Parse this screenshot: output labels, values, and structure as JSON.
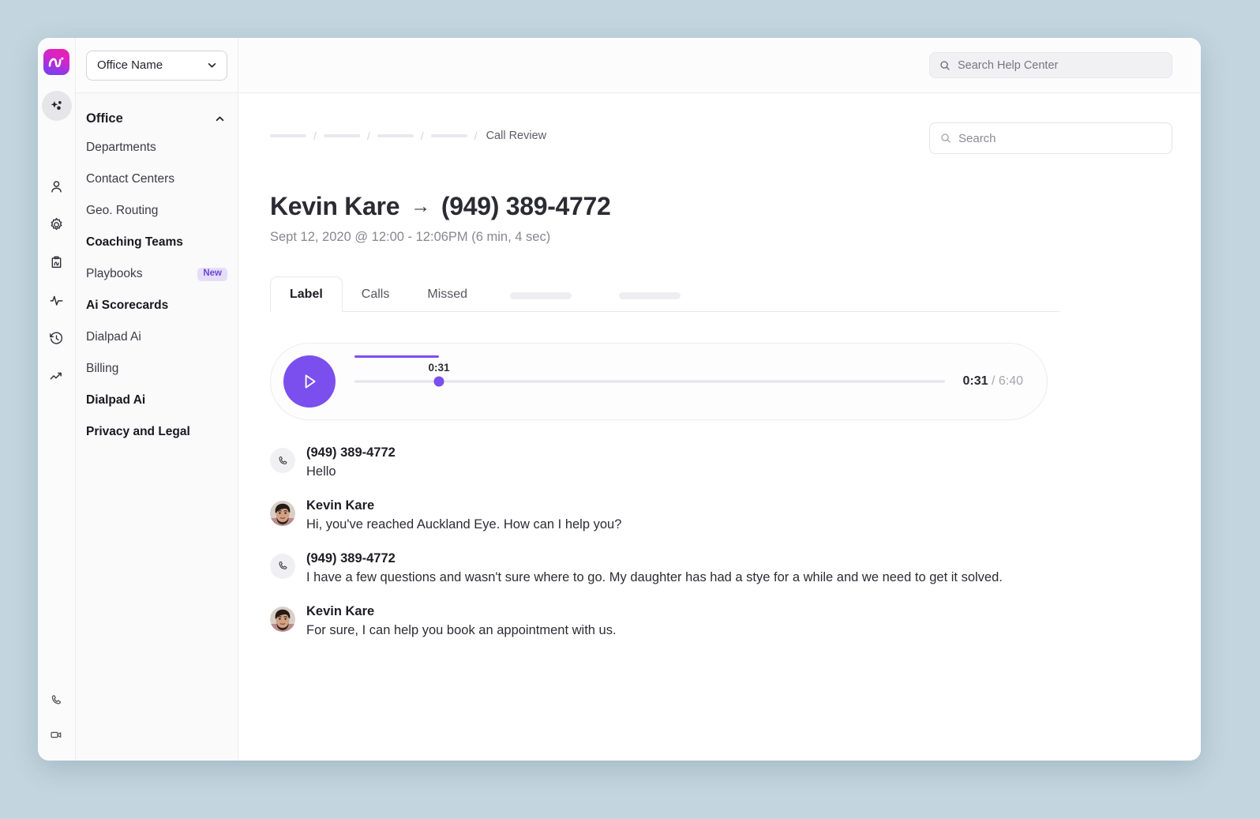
{
  "brand": {
    "logo_icon": "dialpad-ai-logo",
    "accent_purple": "#7b4fee",
    "badge_bg": "#e6def9",
    "badge_fg": "#6b46d6"
  },
  "icon_rail": {
    "items": [
      {
        "icon": "sparkle-ai-icon",
        "name": "ai",
        "active": true
      },
      {
        "icon": "person-icon",
        "name": "contacts",
        "active": false
      },
      {
        "icon": "gear-icon",
        "name": "settings",
        "active": false
      },
      {
        "icon": "clipboard-ai-icon",
        "name": "scorecards",
        "active": false
      },
      {
        "icon": "activity-pulse-icon",
        "name": "activity",
        "active": false
      },
      {
        "icon": "history-clock-icon",
        "name": "history",
        "active": false
      },
      {
        "icon": "trending-up-icon",
        "name": "analytics",
        "active": false
      }
    ],
    "bottom_items": [
      {
        "icon": "phone-icon",
        "name": "calls"
      },
      {
        "icon": "video-camera-icon",
        "name": "meetings"
      }
    ]
  },
  "sidebar": {
    "office_select": {
      "value": "Office Name",
      "chevron_icon": "chevron-down-icon"
    },
    "group": {
      "label": "Office",
      "chevron_icon": "chevron-up-icon"
    },
    "items": [
      {
        "label": "Departments",
        "strong": false,
        "badge": null
      },
      {
        "label": "Contact Centers",
        "strong": false,
        "badge": null
      },
      {
        "label": "Geo. Routing",
        "strong": false,
        "badge": null
      },
      {
        "label": "Coaching Teams",
        "strong": true,
        "badge": null
      },
      {
        "label": "Playbooks",
        "strong": false,
        "badge": "New"
      },
      {
        "label": "Ai Scorecards",
        "strong": true,
        "badge": null
      },
      {
        "label": "Dialpad Ai",
        "strong": false,
        "badge": null
      },
      {
        "label": "Billing",
        "strong": false,
        "badge": null
      },
      {
        "label": "Dialpad Ai",
        "strong": true,
        "badge": null
      },
      {
        "label": "Privacy and Legal",
        "strong": true,
        "badge": null
      }
    ]
  },
  "top_bar": {
    "help_search": {
      "placeholder": "Search Help Center",
      "icon": "search-icon"
    }
  },
  "page": {
    "breadcrumb": {
      "skeleton_count": 4,
      "separator": "/",
      "current": "Call Review"
    },
    "search": {
      "placeholder": "Search",
      "icon": "search-icon"
    },
    "title": {
      "from": "Kevin Kare",
      "arrow": "→",
      "to": "(949) 389-4772"
    },
    "subtitle": "Sept 12, 2020 @ 12:00 - 12:06PM (6 min, 4 sec)",
    "tabs": [
      {
        "label": "Label",
        "active": true,
        "skeleton": false
      },
      {
        "label": "Calls",
        "active": false,
        "skeleton": false
      },
      {
        "label": "Missed",
        "active": false,
        "skeleton": false
      },
      {
        "label": "",
        "active": false,
        "skeleton": true
      },
      {
        "label": "",
        "active": false,
        "skeleton": true
      }
    ]
  },
  "player": {
    "play_icon": "play-icon",
    "state": "paused",
    "current_time": "0:31",
    "tooltip_time": "0:31",
    "total_time": "6:40",
    "separator": "/",
    "progress_percent": 14.3
  },
  "transcript": [
    {
      "speaker": "(949) 389-4772",
      "avatar": "phone-icon",
      "avatar_type": "phone",
      "text": "Hello"
    },
    {
      "speaker": "Kevin Kare",
      "avatar": "agent-photo-avatar",
      "avatar_type": "photo",
      "text": "Hi, you've reached Auckland Eye. How can I help you?"
    },
    {
      "speaker": "(949) 389-4772",
      "avatar": "phone-icon",
      "avatar_type": "phone",
      "text": "I have a few questions and wasn't sure where to go. My daughter has had a stye for a while and we need to get it solved."
    },
    {
      "speaker": "Kevin Kare",
      "avatar": "agent-photo-avatar",
      "avatar_type": "photo",
      "text": "For sure, I can help you book an appointment with us."
    }
  ]
}
